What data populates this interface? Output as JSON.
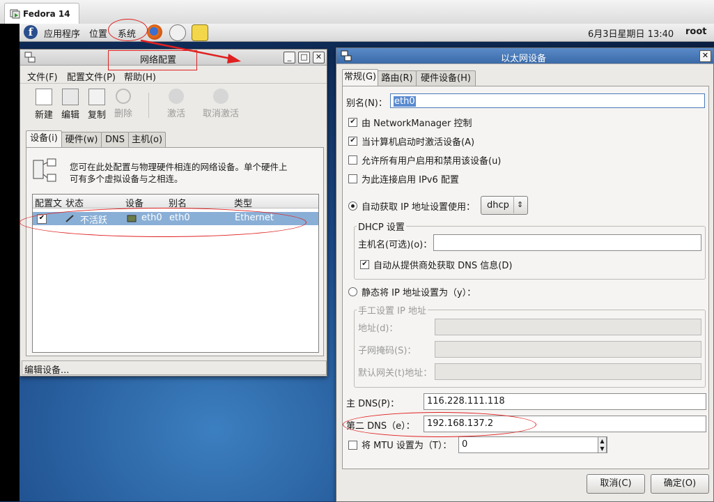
{
  "vm_tab": {
    "title": "Fedora 14"
  },
  "panel": {
    "menus": [
      "应用程序",
      "位置",
      "系统"
    ],
    "clock": "6月3日星期日 13:40",
    "user": "root"
  },
  "netconf": {
    "title": "网络配置",
    "menu": [
      "文件(F)",
      "配置文件(P)",
      "帮助(H)"
    ],
    "toolbar": {
      "new": "新建",
      "edit": "编辑",
      "copy": "复制",
      "delete": "删除",
      "activate": "激活",
      "deactivate": "取消激活"
    },
    "tabs": [
      "设备(i)",
      "硬件(w)",
      "DNS",
      "主机(o)"
    ],
    "description": [
      "您可在此处配置与物理硬件相连的网络设备。单个硬件上",
      "可有多个虚拟设备与之相连。"
    ],
    "columns": [
      "配置文",
      "状态",
      "设备",
      "别名",
      "类型"
    ],
    "row": {
      "status": "不活跃",
      "device": "eth0",
      "alias": "eth0",
      "type": "Ethernet"
    },
    "statusbar": "编辑设备..."
  },
  "eth": {
    "title": "以太网设备",
    "tabs": [
      "常规(G)",
      "路由(R)",
      "硬件设备(H)"
    ],
    "nickname_label": "别名(N)：",
    "nickname_value": "eth0",
    "checks": [
      {
        "label": "由 NetworkManager 控制",
        "checked": true
      },
      {
        "label": "当计算机启动时激活设备(A)",
        "checked": true
      },
      {
        "label": "允许所有用户启用和禁用该设备(u)",
        "checked": false
      },
      {
        "label": "为此连接启用 IPv6 配置",
        "checked": false
      }
    ],
    "auto_label": "自动获取 IP 地址设置使用：",
    "auto_select": "dhcp",
    "dhcp_group": "DHCP 设置",
    "hostname_label": "主机名(可选)(o)：",
    "auto_dns_label": "自动从提供商处获取 DNS 信息(D)",
    "static_label": "静态将 IP 地址设置为（y）：",
    "manual_group": "手工设置 IP 地址",
    "address_label": "地址(d)：",
    "netmask_label": "子网掩码(S)：",
    "gateway_label": "默认网关(t)地址：",
    "dns1_label": "主 DNS(P)：",
    "dns1_value": "116.228.111.118",
    "dns2_label": "第二 DNS（e）：",
    "dns2_value": "192.168.137.2",
    "mtu_label": "将 MTU 设置为（T）：",
    "mtu_value": "0",
    "cancel": "取消(C)",
    "ok": "确定(O)"
  }
}
